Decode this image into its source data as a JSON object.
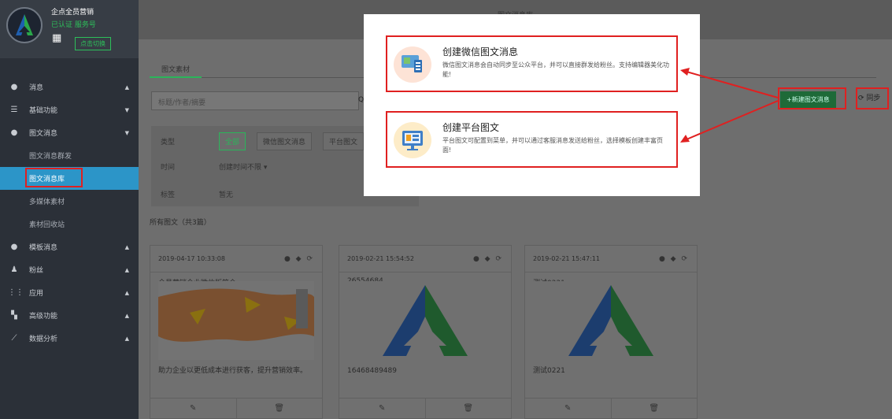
{
  "sidebar": {
    "account_name": "企点全员营销",
    "account_status": "已认证  服务号",
    "switch_label": "点击切换",
    "items": [
      {
        "label": "消息",
        "icon": "chat-icon"
      },
      {
        "label": "基础功能",
        "icon": "grid-icon"
      },
      {
        "label": "图文消息",
        "icon": "chat-icon"
      },
      {
        "label": "模板消息",
        "icon": "chat-icon"
      },
      {
        "label": "粉丝",
        "icon": "user-icon"
      },
      {
        "label": "应用",
        "icon": "apps-icon"
      },
      {
        "label": "高级功能",
        "icon": "grid-icon"
      },
      {
        "label": "数据分析",
        "icon": "chart-icon"
      }
    ],
    "sub_items": [
      "图文消息群发",
      "图文消息库",
      "多媒体素材",
      "素材回收站"
    ]
  },
  "topbar": {
    "title": "图文消息库"
  },
  "tabs": {
    "material": "图文素材"
  },
  "search": {
    "placeholder": "标题/作者/摘要"
  },
  "toolbar": {
    "new_label": "+新建图文消息",
    "sync_label": "同步"
  },
  "filters": {
    "type_label": "类型",
    "type_options": [
      "全部",
      "微信图文消息",
      "平台图文"
    ],
    "time_label": "时间",
    "time_value": "创建时间不限",
    "tag_label": "标签",
    "tag_value": "暂无"
  },
  "count_label": "所有图文（共3篇）",
  "cards": [
    {
      "date": "2019-04-17 10:33:08",
      "title": "全员营销企业微信版简介",
      "desc": "助力企业以更低成本进行获客，提升营销效率。"
    },
    {
      "date": "2019-02-21 15:54:52",
      "title": "26554684",
      "desc": "16468489489"
    },
    {
      "date": "2019-02-21 15:47:11",
      "title": "测试0221",
      "desc": "测试0221"
    }
  ],
  "modal": {
    "wechat": {
      "title": "创建微信图文消息",
      "desc": "微信图文消息会自动同步至公众平台，并可以直接群发给粉丝。支持编辑器美化功能!"
    },
    "platform": {
      "title": "创建平台图文",
      "desc": "平台图文可配置到菜单，并可以通过客服消息发送给粉丝，选择模板创建丰富页面!"
    }
  },
  "colors": {
    "accent": "#2bb55a",
    "active": "#2c95c8",
    "highlight": "#e02020",
    "sidebar": "#2b3038"
  }
}
